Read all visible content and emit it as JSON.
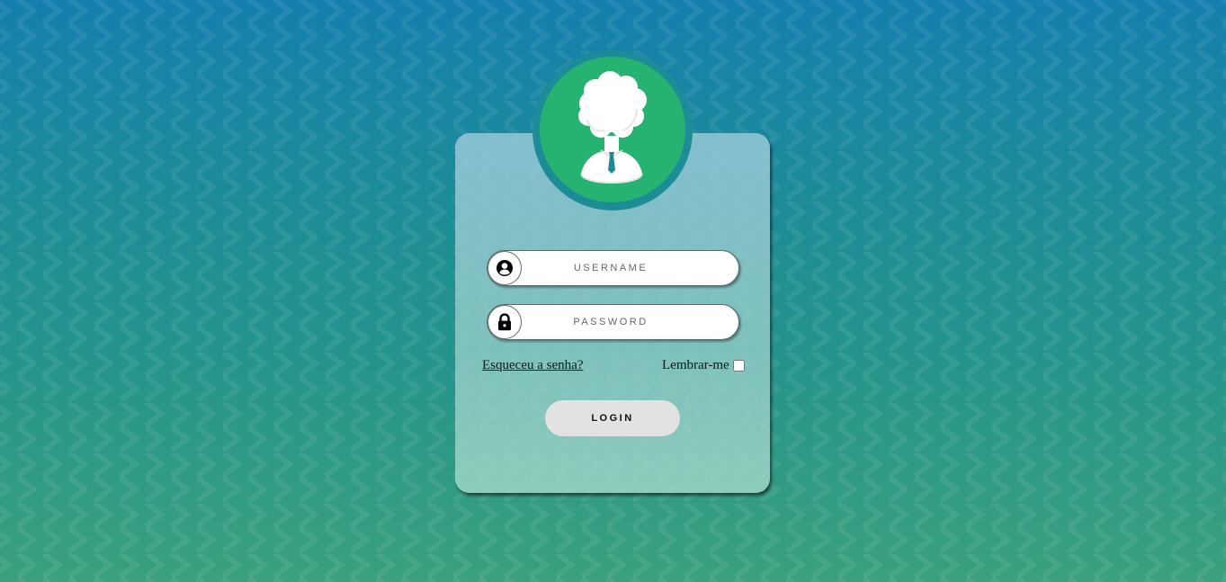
{
  "background": {
    "gradient_top": "#157fae",
    "gradient_bottom": "#3aa07d",
    "pattern_icon": "chevron-pattern"
  },
  "avatar": {
    "icon": "user-avatar-icon",
    "color": "#26b372",
    "tie_color": "#1a8a95"
  },
  "form": {
    "username": {
      "icon": "user-circle-icon",
      "placeholder": "USERNAME",
      "value": ""
    },
    "password": {
      "icon": "lock-icon",
      "placeholder": "PASSWORD",
      "value": ""
    },
    "forgot_password_label": "Esqueceu a senha?",
    "remember_me_label": "Lembrar-me",
    "remember_me_checked": false,
    "login_button_label": "LOGIN"
  }
}
